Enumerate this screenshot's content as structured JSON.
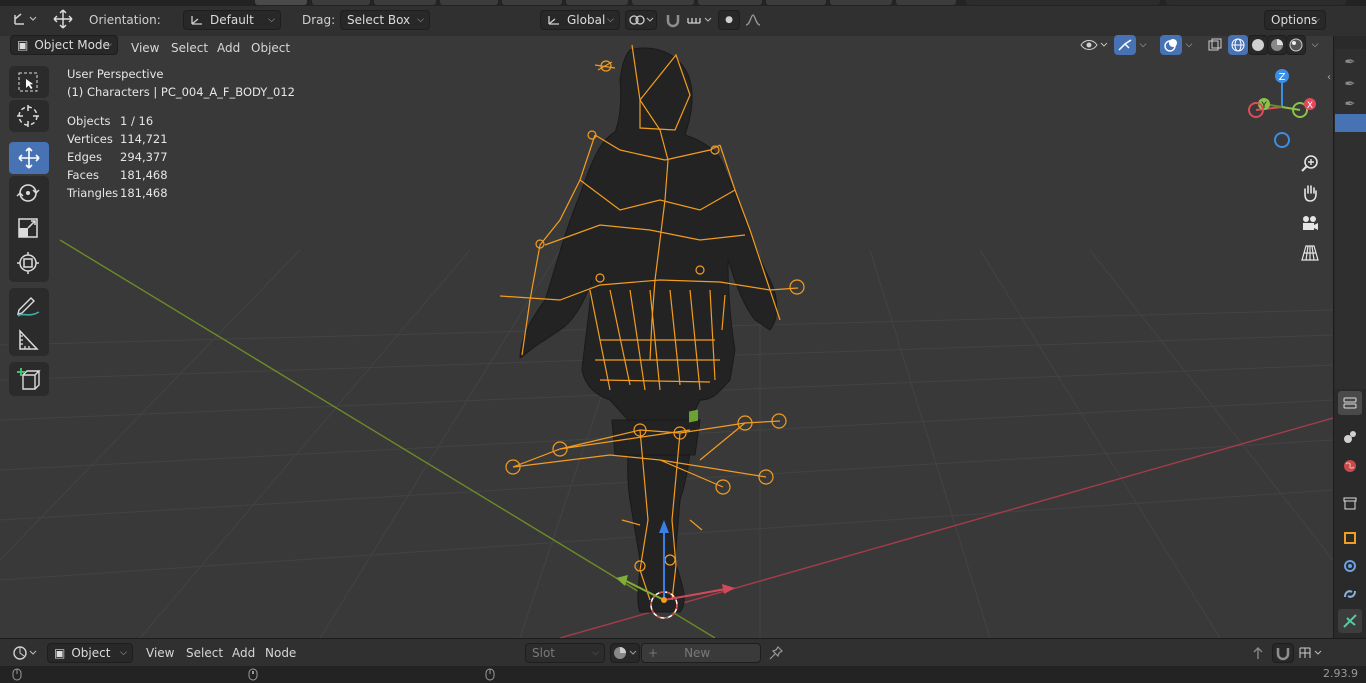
{
  "tool_header": {
    "orientation_label": "Orientation:",
    "orientation_value": "Default",
    "drag_label": "Drag:",
    "drag_value": "Select Box",
    "transform_orientation": "Global",
    "options_label": "Options"
  },
  "viewport_header": {
    "mode": "Object Mode",
    "menus": [
      "View",
      "Select",
      "Add",
      "Object"
    ]
  },
  "overlay": {
    "perspective": "User Perspective",
    "collection": "(1) Characters | PC_004_A_F_BODY_012",
    "stats": [
      {
        "label": "Objects",
        "value": "1 / 16"
      },
      {
        "label": "Vertices",
        "value": "114,721"
      },
      {
        "label": "Edges",
        "value": "294,377"
      },
      {
        "label": "Faces",
        "value": "181,468"
      },
      {
        "label": "Triangles",
        "value": "181,468"
      }
    ]
  },
  "gizmo": {
    "z_label": "Z",
    "y_label": "Y",
    "x_label": "X",
    "colors": {
      "x": "#e04a5c",
      "y": "#8bc34a",
      "z": "#3a8ee6"
    }
  },
  "toolbar": {
    "tools": [
      "select-box",
      "cursor",
      "move",
      "rotate",
      "scale",
      "transform",
      "annotate",
      "measure",
      "add-cube"
    ],
    "active": "move"
  },
  "bottom_header": {
    "type": "Object",
    "menus": [
      "View",
      "Select",
      "Add",
      "Node"
    ],
    "slot_label": "Slot",
    "new_label": "New"
  },
  "version": "2.93.9",
  "colors": {
    "accent": "#4772b3",
    "armature": "#f39c1f",
    "background": "#393939",
    "header": "#303030",
    "x_axis": "#a43c4a",
    "y_axis": "#6c8a26"
  }
}
